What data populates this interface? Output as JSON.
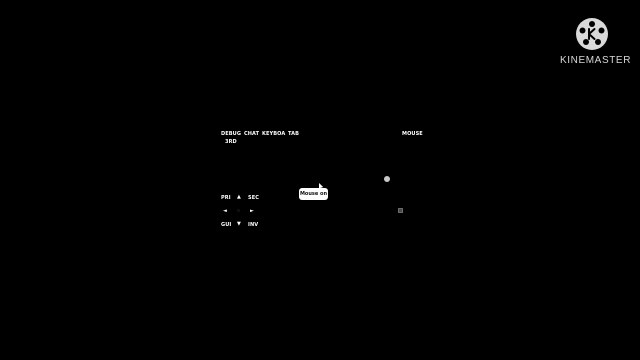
{
  "top_controls": {
    "debug": "DEBUG",
    "chat": "CHAT",
    "keyboard": "KEYBOA",
    "tab": "TAB",
    "mouse": "MOUSE",
    "view3d": "3RD"
  },
  "left_controls": {
    "primary": "PRI",
    "secondary": "SEC",
    "gui": "GUI",
    "inventory": "INV",
    "up_arrow": "▲",
    "down_arrow": "▼",
    "left_arrow": "◄",
    "right_arrow": "►"
  },
  "toast": {
    "text": "Mouse on"
  },
  "watermark": {
    "text_pre": "KINE",
    "text_post": "MASTER"
  },
  "icons": {
    "cursor": "mouse-pointer-icon",
    "logo": "kinemaster-logo-icon"
  }
}
